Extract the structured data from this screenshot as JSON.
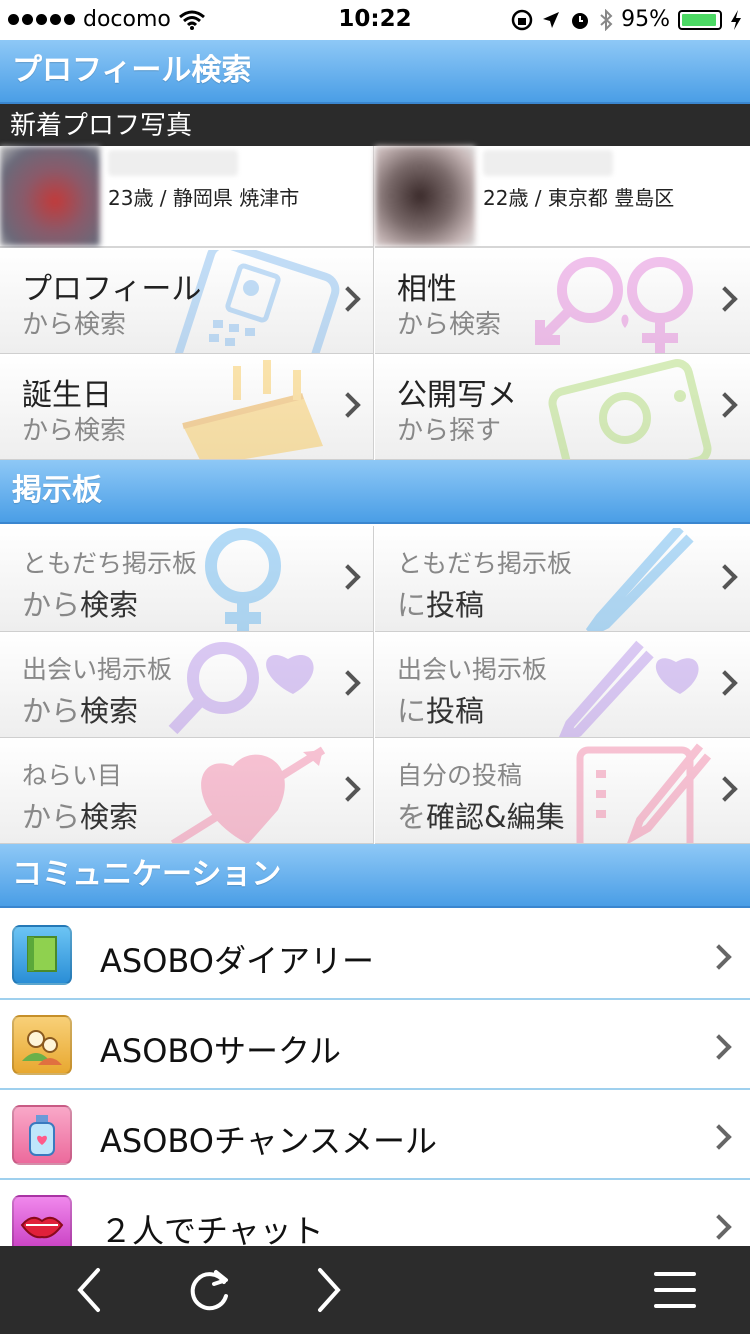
{
  "status_bar": {
    "carrier": "docomo",
    "time": "10:22",
    "battery": "95%",
    "battery_level": 0.95,
    "icons": [
      "wifi-icon",
      "orientation-lock-icon",
      "location-icon",
      "alarm-icon",
      "bluetooth-icon",
      "battery-icon",
      "charging-icon"
    ]
  },
  "profile_search": {
    "title": "プロフィール検索",
    "new_photos_label": "新着プロフ写真",
    "photos": [
      {
        "info": "23歳 / 静岡県 焼津市"
      },
      {
        "info": "22歳 / 東京都 豊島区"
      }
    ],
    "tiles": [
      {
        "line1": "プロフィール",
        "line2": "から検索",
        "icon": "id-card-icon"
      },
      {
        "line1": "相性",
        "line2": "から検索",
        "icon": "gender-symbols-icon"
      },
      {
        "line1": "誕生日",
        "line2": "から検索",
        "icon": "birthday-cake-icon"
      },
      {
        "line1": "公開写メ",
        "line2": "から探す",
        "icon": "photo-icon"
      }
    ]
  },
  "bulletin_board": {
    "title": "掲示板",
    "tiles": [
      {
        "line1": "ともだち掲示板",
        "line2a": "から",
        "line2b": "検索",
        "icon": "magnifier-icon"
      },
      {
        "line1": "ともだち掲示板",
        "line2a": "に",
        "line2b": "投稿",
        "icon": "pen-icon"
      },
      {
        "line1": "出会い掲示板",
        "line2a": "から",
        "line2b": "検索",
        "icon": "heart-magnifier-icon"
      },
      {
        "line1": "出会い掲示板",
        "line2a": "に",
        "line2b": "投稿",
        "icon": "heart-pen-icon"
      },
      {
        "line1": "ねらい目",
        "line2a": "から",
        "line2b": "検索",
        "icon": "heart-arrow-icon"
      },
      {
        "line1": "自分の投稿",
        "line2a": "を",
        "line2b": "確認&編集",
        "icon": "edit-icon"
      }
    ]
  },
  "communication": {
    "title": "コミュニケーション",
    "items": [
      {
        "label": "ASOBOダイアリー",
        "icon": "diary-icon",
        "color": "#3aa0e6"
      },
      {
        "label": "ASOBOサークル",
        "icon": "circle-group-icon",
        "color": "#f0b23a"
      },
      {
        "label": "ASOBOチャンスメール",
        "icon": "bottle-mail-icon",
        "color": "#f27aa8"
      },
      {
        "label": "２人でチャット",
        "icon": "lips-icon",
        "color": "#d94fd0"
      }
    ]
  },
  "toolbar": {
    "buttons": [
      "back-icon",
      "reload-icon",
      "forward-icon",
      "menu-icon"
    ]
  },
  "colors": {
    "header_top": "#8ec8f6",
    "header_bottom": "#4a9ee6",
    "toolbar": "#2c2c2c",
    "battery_fill": "#4cd964"
  }
}
